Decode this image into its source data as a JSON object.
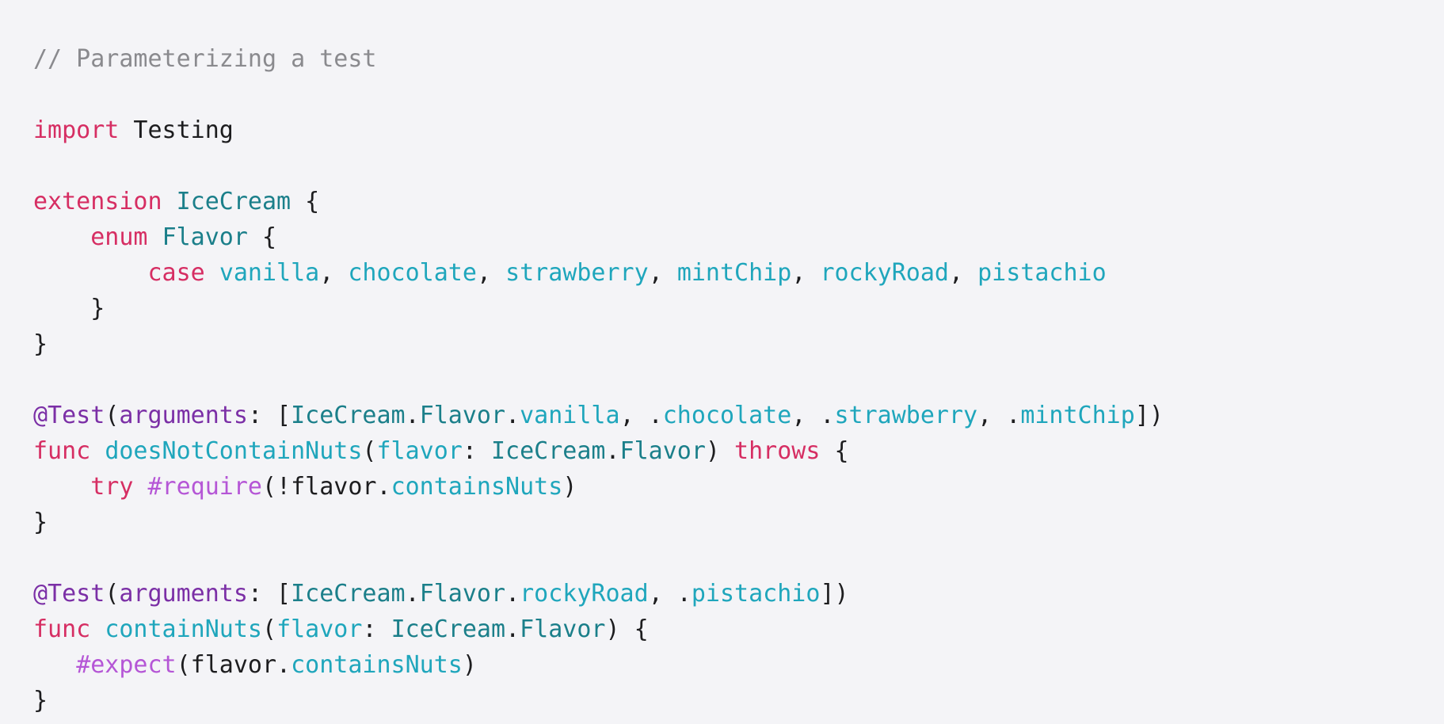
{
  "colors": {
    "background": "#f4f4f7",
    "comment": "#8a8a8e",
    "keyword": "#d62e63",
    "type": "#1b7f8a",
    "member": "#1fa6bc",
    "attribute": "#7b2fa6",
    "macro": "#b556d6",
    "plain": "#1d1d1f"
  },
  "code_lines": [
    [
      {
        "kind": "comment",
        "text": "// Parameterizing a test"
      }
    ],
    [],
    [
      {
        "kind": "keyword",
        "text": "import"
      },
      {
        "kind": "plain",
        "text": " Testing"
      }
    ],
    [],
    [
      {
        "kind": "keyword",
        "text": "extension"
      },
      {
        "kind": "plain",
        "text": " "
      },
      {
        "kind": "type",
        "text": "IceCream"
      },
      {
        "kind": "plain",
        "text": " {"
      }
    ],
    [
      {
        "kind": "plain",
        "text": "    "
      },
      {
        "kind": "keyword",
        "text": "enum"
      },
      {
        "kind": "plain",
        "text": " "
      },
      {
        "kind": "type",
        "text": "Flavor"
      },
      {
        "kind": "plain",
        "text": " {"
      }
    ],
    [
      {
        "kind": "plain",
        "text": "        "
      },
      {
        "kind": "keyword",
        "text": "case"
      },
      {
        "kind": "plain",
        "text": " "
      },
      {
        "kind": "member",
        "text": "vanilla"
      },
      {
        "kind": "plain",
        "text": ", "
      },
      {
        "kind": "member",
        "text": "chocolate"
      },
      {
        "kind": "plain",
        "text": ", "
      },
      {
        "kind": "member",
        "text": "strawberry"
      },
      {
        "kind": "plain",
        "text": ", "
      },
      {
        "kind": "member",
        "text": "mintChip"
      },
      {
        "kind": "plain",
        "text": ", "
      },
      {
        "kind": "member",
        "text": "rockyRoad"
      },
      {
        "kind": "plain",
        "text": ", "
      },
      {
        "kind": "member",
        "text": "pistachio"
      }
    ],
    [
      {
        "kind": "plain",
        "text": "    }"
      }
    ],
    [
      {
        "kind": "plain",
        "text": "}"
      }
    ],
    [],
    [
      {
        "kind": "attr",
        "text": "@Test"
      },
      {
        "kind": "plain",
        "text": "("
      },
      {
        "kind": "attr",
        "text": "arguments"
      },
      {
        "kind": "plain",
        "text": ": ["
      },
      {
        "kind": "type",
        "text": "IceCream"
      },
      {
        "kind": "plain",
        "text": "."
      },
      {
        "kind": "type",
        "text": "Flavor"
      },
      {
        "kind": "plain",
        "text": "."
      },
      {
        "kind": "member",
        "text": "vanilla"
      },
      {
        "kind": "plain",
        "text": ", ."
      },
      {
        "kind": "member",
        "text": "chocolate"
      },
      {
        "kind": "plain",
        "text": ", ."
      },
      {
        "kind": "member",
        "text": "strawberry"
      },
      {
        "kind": "plain",
        "text": ", ."
      },
      {
        "kind": "member",
        "text": "mintChip"
      },
      {
        "kind": "plain",
        "text": "])"
      }
    ],
    [
      {
        "kind": "keyword",
        "text": "func"
      },
      {
        "kind": "plain",
        "text": " "
      },
      {
        "kind": "member",
        "text": "doesNotContainNuts"
      },
      {
        "kind": "plain",
        "text": "("
      },
      {
        "kind": "member",
        "text": "flavor"
      },
      {
        "kind": "plain",
        "text": ": "
      },
      {
        "kind": "type",
        "text": "IceCream"
      },
      {
        "kind": "plain",
        "text": "."
      },
      {
        "kind": "type",
        "text": "Flavor"
      },
      {
        "kind": "plain",
        "text": ") "
      },
      {
        "kind": "keyword",
        "text": "throws"
      },
      {
        "kind": "plain",
        "text": " {"
      }
    ],
    [
      {
        "kind": "plain",
        "text": "    "
      },
      {
        "kind": "keyword",
        "text": "try"
      },
      {
        "kind": "plain",
        "text": " "
      },
      {
        "kind": "macro",
        "text": "#require"
      },
      {
        "kind": "plain",
        "text": "(!flavor."
      },
      {
        "kind": "member",
        "text": "containsNuts"
      },
      {
        "kind": "plain",
        "text": ")"
      }
    ],
    [
      {
        "kind": "plain",
        "text": "}"
      }
    ],
    [],
    [
      {
        "kind": "attr",
        "text": "@Test"
      },
      {
        "kind": "plain",
        "text": "("
      },
      {
        "kind": "attr",
        "text": "arguments"
      },
      {
        "kind": "plain",
        "text": ": ["
      },
      {
        "kind": "type",
        "text": "IceCream"
      },
      {
        "kind": "plain",
        "text": "."
      },
      {
        "kind": "type",
        "text": "Flavor"
      },
      {
        "kind": "plain",
        "text": "."
      },
      {
        "kind": "member",
        "text": "rockyRoad"
      },
      {
        "kind": "plain",
        "text": ", ."
      },
      {
        "kind": "member",
        "text": "pistachio"
      },
      {
        "kind": "plain",
        "text": "])"
      }
    ],
    [
      {
        "kind": "keyword",
        "text": "func"
      },
      {
        "kind": "plain",
        "text": " "
      },
      {
        "kind": "member",
        "text": "containNuts"
      },
      {
        "kind": "plain",
        "text": "("
      },
      {
        "kind": "member",
        "text": "flavor"
      },
      {
        "kind": "plain",
        "text": ": "
      },
      {
        "kind": "type",
        "text": "IceCream"
      },
      {
        "kind": "plain",
        "text": "."
      },
      {
        "kind": "type",
        "text": "Flavor"
      },
      {
        "kind": "plain",
        "text": ") {"
      }
    ],
    [
      {
        "kind": "plain",
        "text": "   "
      },
      {
        "kind": "macro",
        "text": "#expect"
      },
      {
        "kind": "plain",
        "text": "(flavor."
      },
      {
        "kind": "member",
        "text": "containsNuts"
      },
      {
        "kind": "plain",
        "text": ")"
      }
    ],
    [
      {
        "kind": "plain",
        "text": "}"
      }
    ]
  ]
}
